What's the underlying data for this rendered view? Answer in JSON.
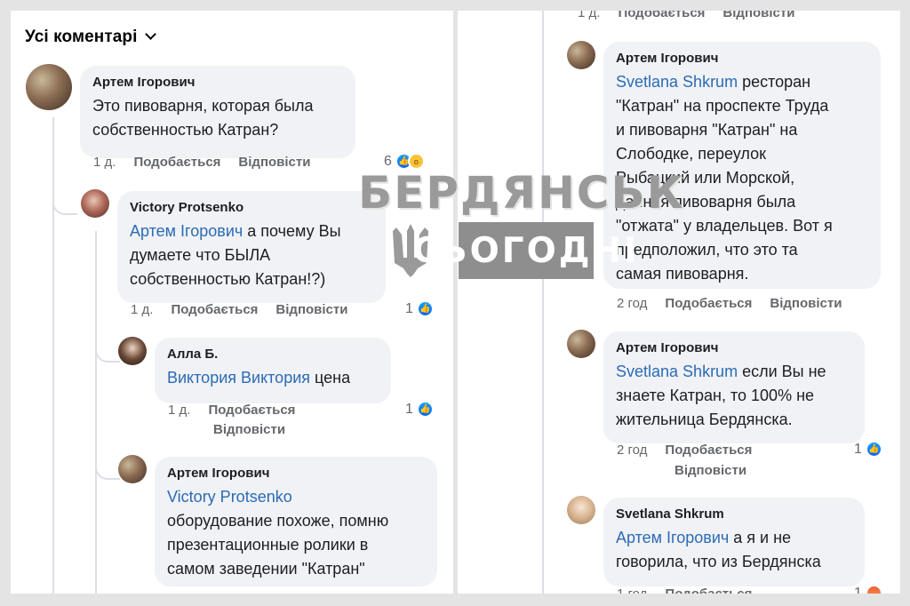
{
  "header": {
    "title": "Усі коментарі"
  },
  "left": {
    "comments": [
      {
        "author": "Артем Ігорович",
        "mention": "",
        "text_lines": [
          "Это пивоварня, которая была",
          "собственностью Катран?"
        ],
        "time": "1 д.",
        "like": "Подобається",
        "reply": "Відповісти",
        "reactions": "6"
      },
      {
        "author": "Victory Protsenko",
        "mention": "Артем Ігорович",
        "first_line_rest": " а почему Вы",
        "text_lines": [
          "думаете что БЫЛА",
          "собственностью Катран!?)"
        ],
        "time": "1 д.",
        "like": "Подобається",
        "reply": "Відповісти",
        "reactions": "1"
      },
      {
        "author": "Алла Б.",
        "mention": "Виктория Виктория",
        "first_line_rest": " цена",
        "time": "1 д.",
        "like": "Подобається",
        "reply": "Відповісти",
        "reactions": "1"
      },
      {
        "author": "Артем Ігорович",
        "mention": "Victory Protsenko",
        "text_lines": [
          "оборудование похоже, помню",
          "презентационные ролики в",
          "самом заведении \"Катран\""
        ]
      }
    ]
  },
  "right": {
    "top_meta": {
      "time": "1 д.",
      "like": "Подобається",
      "reply": "Відповісти"
    },
    "comments": [
      {
        "author": "Артем Ігорович",
        "mention": "Svetlana Shkrum",
        "first_line_rest": " ресторан",
        "text_lines": [
          "\"Катран\" на проспекте Труда",
          "и пивоварня \"Катран\" на",
          "Слободке, переулок",
          "Рыбацкий или Морской,",
          "данная пивоварня была",
          "\"отжата\" у владельцев. Вот  я",
          "предположил, что это та",
          "самая пивоварня."
        ],
        "time": "2 год",
        "like": "Подобається",
        "reply": "Відповісти"
      },
      {
        "author": "Артем Ігорович",
        "mention": "Svetlana Shkrum",
        "first_line_rest": " если Вы не",
        "text_lines": [
          "знаете Катран, то 100% не",
          "жительница Бердянска."
        ],
        "time": "2 год",
        "like": "Подобається",
        "reply": "Відповісти",
        "reactions": "1"
      },
      {
        "author": "Svetlana Shkrum",
        "mention": "Артем Ігорович",
        "first_line_rest": " а я и не",
        "text_lines": [
          "говорила, что из Бердянска"
        ],
        "time": "1 год",
        "like": "Подобається",
        "reactions": "1"
      }
    ]
  },
  "watermark": {
    "line1": "БЕРДЯНСЬК",
    "line2": "СЬОГОДНІ"
  },
  "colors": {
    "mention": "#2c6bb5",
    "bubble": "#f0f2f5",
    "like": "#0766ff",
    "meta": "#65676b"
  }
}
